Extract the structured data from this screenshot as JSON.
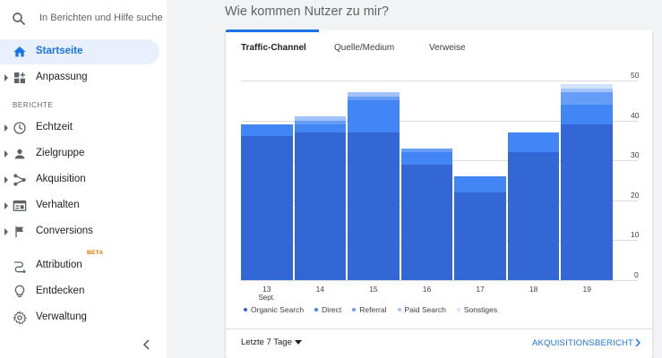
{
  "search": {
    "text": "In Berichten und Hilfe suche"
  },
  "sidebar": {
    "section_label": "BERICHTE",
    "items": [
      {
        "label": "Startseite",
        "icon": "home-icon"
      },
      {
        "label": "Anpassung",
        "icon": "dashboard-icon"
      },
      {
        "label": "Echtzeit",
        "icon": "clock-icon"
      },
      {
        "label": "Zielgruppe",
        "icon": "person-icon"
      },
      {
        "label": "Akquisition",
        "icon": "acquisition-icon"
      },
      {
        "label": "Verhalten",
        "icon": "behavior-icon"
      },
      {
        "label": "Conversions",
        "icon": "flag-icon"
      },
      {
        "label": "Attribution",
        "icon": "attribution-icon",
        "badge": "BETA"
      },
      {
        "label": "Entdecken",
        "icon": "lightbulb-icon"
      },
      {
        "label": "Verwaltung",
        "icon": "gear-icon"
      }
    ]
  },
  "main": {
    "title": "Wie kommen Nutzer zu mir?",
    "tabs": [
      "Traffic-Channel",
      "Quelle/Medium",
      "Verweise"
    ],
    "date_range": "Letzte 7 Tage",
    "report_link": "AKQUISITIONSBERICHT"
  },
  "colors": {
    "accent": "#1a73e8",
    "organic": "#3367d6",
    "direct": "#4285f4",
    "referral": "#669df6",
    "paid": "#a1c2fa",
    "other": "#d2e3fc"
  },
  "chart_data": {
    "type": "bar",
    "stacked": true,
    "categories": [
      "13",
      "14",
      "15",
      "16",
      "17",
      "18",
      "19"
    ],
    "category_sublabels": [
      "Sept.",
      "",
      "",
      "",
      "",
      "",
      ""
    ],
    "series": [
      {
        "name": "Organic Search",
        "values": [
          36,
          37,
          37,
          29,
          22,
          32,
          39
        ]
      },
      {
        "name": "Direct",
        "values": [
          3,
          2,
          8,
          3,
          4,
          5,
          5
        ]
      },
      {
        "name": "Referral",
        "values": [
          0,
          1,
          1,
          1,
          0,
          0,
          3
        ]
      },
      {
        "name": "Paid Search",
        "values": [
          0,
          1,
          1,
          0,
          0,
          0,
          1
        ]
      },
      {
        "name": "Sonstiges",
        "values": [
          0,
          0,
          0,
          0,
          0,
          0,
          1
        ]
      }
    ],
    "yaxis_position": "right",
    "yticks": [
      0,
      10,
      20,
      30,
      40,
      50
    ],
    "ylim": [
      0,
      50
    ],
    "grid": true,
    "legend_position": "bottom"
  }
}
